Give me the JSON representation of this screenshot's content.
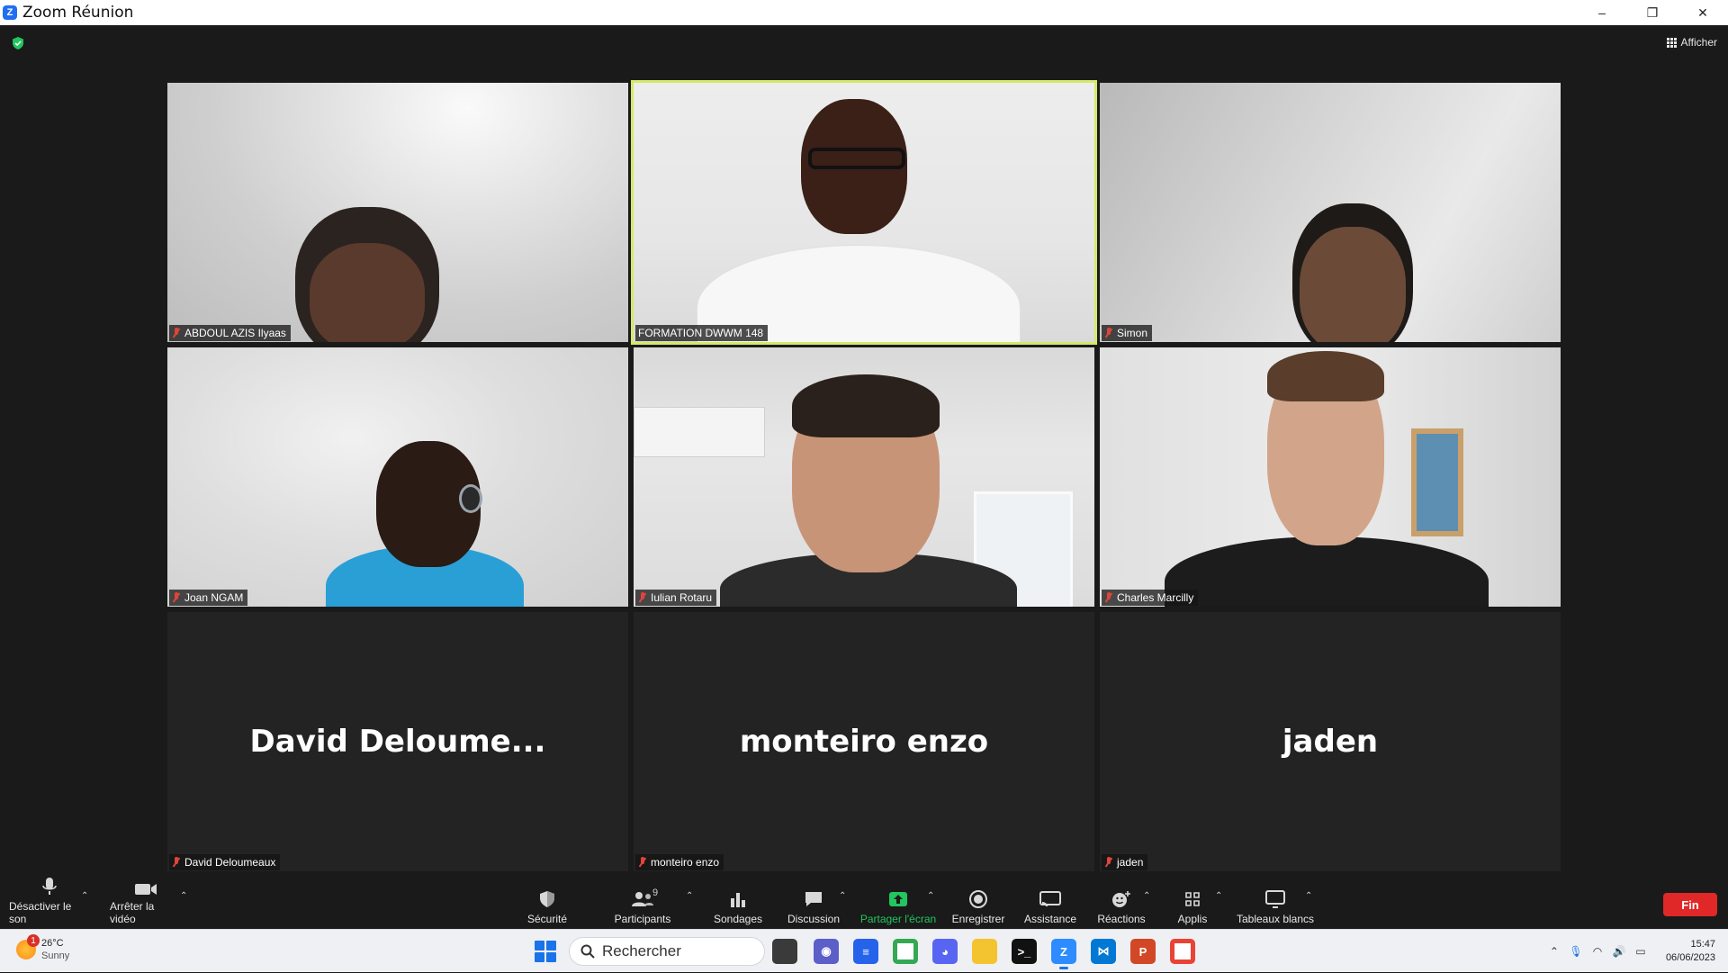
{
  "window": {
    "title": "Zoom Réunion",
    "minimize": "–",
    "restore": "❐",
    "close": "✕"
  },
  "meeting": {
    "view_label": "Afficher",
    "participants": [
      {
        "name": "ABDOUL AZIS Ilyaas",
        "muted": true,
        "video": true
      },
      {
        "name": "FORMATION DWWM 148",
        "muted": false,
        "video": true,
        "active_speaker": true
      },
      {
        "name": "Simon",
        "muted": true,
        "video": true
      },
      {
        "name": "Joan NGAM",
        "muted": true,
        "video": true
      },
      {
        "name": "Iulian Rotaru",
        "muted": true,
        "video": true
      },
      {
        "name": "Charles Marcilly",
        "muted": true,
        "video": true
      },
      {
        "name": "David Deloumeaux",
        "display_name": "David  Deloume...",
        "muted": true,
        "video": false
      },
      {
        "name": "monteiro enzo",
        "display_name": "monteiro enzo",
        "muted": true,
        "video": false
      },
      {
        "name": "jaden",
        "display_name": "jaden",
        "muted": true,
        "video": false
      }
    ]
  },
  "toolbar": {
    "mute": "Désactiver le son",
    "video": "Arrêter la vidéo",
    "security": "Sécurité",
    "participants": "Participants",
    "participants_count": "9",
    "polls": "Sondages",
    "chat": "Discussion",
    "share": "Partager l'écran",
    "record": "Enregistrer",
    "assist": "Assistance",
    "reactions": "Réactions",
    "apps": "Applis",
    "whiteboards": "Tableaux blancs",
    "end": "Fin"
  },
  "taskbar": {
    "weather_temp": "26°C",
    "weather_cond": "Sunny",
    "weather_badge": "1",
    "search_placeholder": "Rechercher",
    "time": "15:47",
    "date": "06/06/2023"
  },
  "colors": {
    "active_border": "#d6e86a",
    "share_green": "#22c55e",
    "end_red": "#e02828",
    "muted_red": "#e0443a"
  }
}
